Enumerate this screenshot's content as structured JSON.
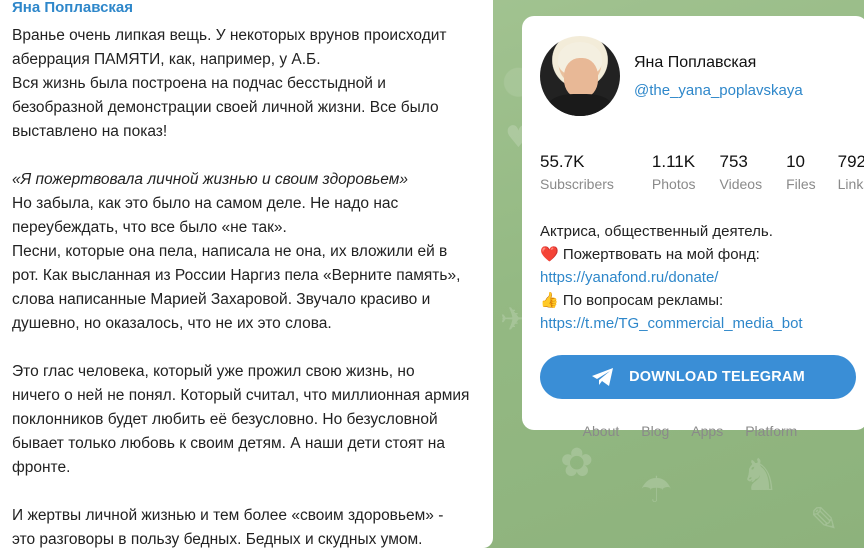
{
  "message": {
    "author": "Яна Поплавская",
    "p1": [
      "Вранье очень липкая вещь. У некоторых врунов происходит",
      "аберрация ПАМЯТИ, как, например, у А.Б.",
      "Вся жизнь была построена на подчас бесстыдной и",
      "безобразной демонстрации своей личной жизни. Все было",
      "выставлено на показ!"
    ],
    "quote": "«Я пожертвовала личной жизнью и своим здоровьем»",
    "p2": [
      "Но забыла, как это было на самом деле. Не надо нас",
      "переубеждать, что все было «не так».",
      "Песни, которые она пела, написала не она, их вложили ей в",
      "рот. Как высланная из России Наргиз пела «Верните память»,",
      "слова написанные Марией Захаровой. Звучало красиво и",
      "душевно, но оказалось, что не их это слова."
    ],
    "p3": [
      "Это глас человека, который уже прожил свою жизнь, но",
      "ничего о ней не понял. Который считал, что миллионная армия",
      "поклонников будет любить её безусловно. Но безусловной",
      "бывает только любовь к своим детям. А наши дети стоят на",
      "фронте."
    ],
    "p4": [
      "И жертвы личной жизнью и тем более «своим здоровьем» -",
      "это разговоры в пользу бедных. Бедных и скудных умом."
    ]
  },
  "channel": {
    "name": "Яна Поплавская",
    "handle": "@the_yana_poplavskaya",
    "stats": [
      {
        "value": "55.7K",
        "label": "Subscribers"
      },
      {
        "value": "1.11K",
        "label": "Photos"
      },
      {
        "value": "753",
        "label": "Videos"
      },
      {
        "value": "10",
        "label": "Files"
      },
      {
        "value": "792",
        "label": "Links"
      }
    ],
    "description": {
      "line1": "Актриса, общественный деятель.",
      "heart_emoji": "❤️",
      "line2": "Пожертвовать на мой фонд:",
      "link1": "https://yanafond.ru/donate/",
      "thumb_emoji": "👍",
      "line3": "По вопросам рекламы:",
      "link2": "https://t.me/TG_commercial_media_bot"
    },
    "download_label": "DOWNLOAD TELEGRAM"
  },
  "footer": {
    "links": [
      "About",
      "Blog",
      "Apps",
      "Platform"
    ]
  },
  "colors": {
    "accent": "#2e87ca",
    "button": "#3a8ed6",
    "background": "#9fc08f"
  }
}
